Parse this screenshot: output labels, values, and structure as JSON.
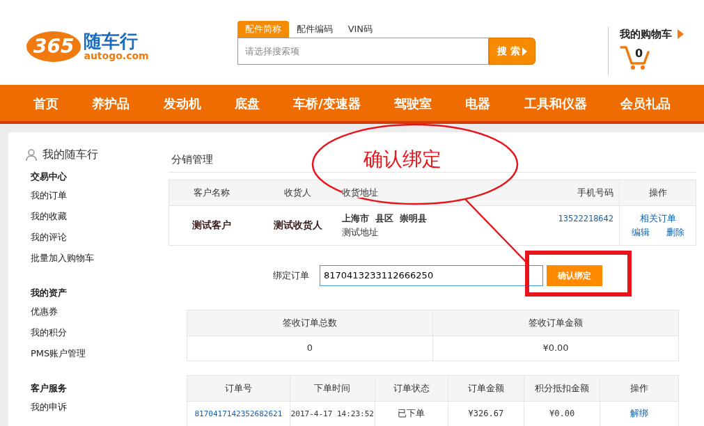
{
  "logo": {
    "badge": "365",
    "name": "随车行",
    "domain": "autogo.com"
  },
  "search": {
    "tabs": [
      {
        "label": "配件简称",
        "selected": true
      },
      {
        "label": "配件编码",
        "selected": false
      },
      {
        "label": "VIN码",
        "selected": false
      }
    ],
    "placeholder": "请选择搜索项",
    "button": "搜 索"
  },
  "cart": {
    "label": "我的购物车",
    "count": "0"
  },
  "nav": [
    "首页",
    "养护品",
    "发动机",
    "底盘",
    "车桥/变速器",
    "驾驶室",
    "电器",
    "工具和仪器",
    "会员礼品"
  ],
  "sidebar": {
    "title": "我的随车行",
    "groups": [
      {
        "heading": "交易中心",
        "items": [
          "我的订单",
          "我的收藏",
          "我的评论",
          "批量加入购物车"
        ]
      },
      {
        "heading": "我的资产",
        "items": [
          "优惠券",
          "我的积分",
          "PMS账户管理"
        ]
      },
      {
        "heading": "客户服务",
        "items": [
          "我的申诉"
        ]
      }
    ]
  },
  "section_title": "分销管理",
  "customer_table": {
    "columns": [
      "客户名称",
      "收货人",
      "收货地址",
      "手机号码",
      "操作"
    ],
    "rows": [
      {
        "customer": "测试客户",
        "receiver": "测试收货人",
        "address_line": "上海市  县区  崇明县",
        "address_detail": "测试地址",
        "phone": "13522218642",
        "actions": [
          "相关订单",
          "编辑",
          "删除"
        ]
      }
    ]
  },
  "bind": {
    "label": "绑定订单",
    "value": "8170413233112666250",
    "button": "确认绑定"
  },
  "summary_table": {
    "columns": [
      "签收订单总数",
      "签收订单金额"
    ],
    "rows": [
      [
        "0",
        "¥0.00"
      ]
    ]
  },
  "orders_table": {
    "columns": [
      "订单号",
      "下单时间",
      "订单状态",
      "订单金额",
      "积分抵扣金额",
      "操作"
    ],
    "rows": [
      {
        "order_no": "8170417142352682621",
        "time": "2017-4-17 14:23:52",
        "status": "已下单",
        "amount": "¥326.67",
        "points": "¥0.00",
        "action": "解绑"
      }
    ]
  },
  "annotation": {
    "text": "确认绑定"
  }
}
